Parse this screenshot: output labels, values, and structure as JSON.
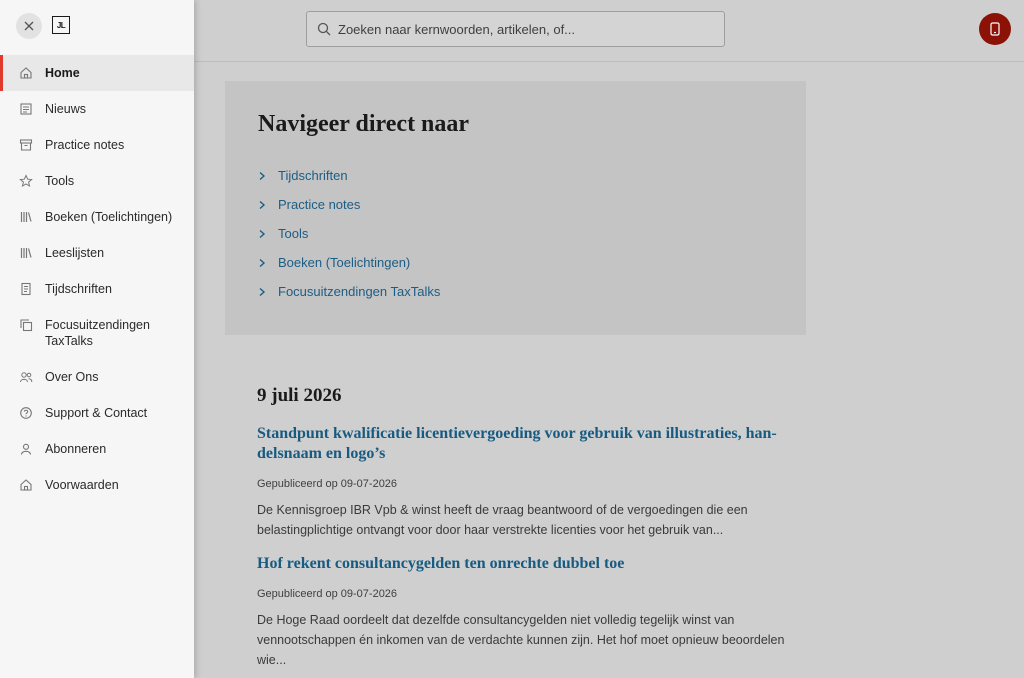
{
  "search": {
    "placeholder": "Zoeken naar kernwoorden, artikelen, of..."
  },
  "colors": {
    "accent": "#e03a2f",
    "user_button": "#8c1208",
    "link": "#1c5d85"
  },
  "drawer": {
    "logo": "JL",
    "menu": [
      {
        "label": "Home",
        "icon": "home-icon",
        "active": true
      },
      {
        "label": "Nieuws",
        "icon": "newspaper-icon"
      },
      {
        "label": "Practice notes",
        "icon": "archive-icon"
      },
      {
        "label": "Tools",
        "icon": "star-icon"
      },
      {
        "label": "Boeken (Toelichtingen)",
        "icon": "books-icon"
      },
      {
        "label": "Leeslijsten",
        "icon": "books-icon"
      },
      {
        "label": "Tijdschriften",
        "icon": "document-icon"
      },
      {
        "label": "Focusuitzendingen TaxTalks",
        "icon": "copy-icon"
      },
      {
        "label": "Over Ons",
        "icon": "users-icon"
      },
      {
        "label": "Support & Contact",
        "icon": "help-icon"
      },
      {
        "label": "Abonneren",
        "icon": "user-icon"
      },
      {
        "label": "Voorwaarden",
        "icon": "home-icon"
      }
    ]
  },
  "main": {
    "nav_title": "Navigeer direct naar",
    "nav_links": [
      "Tijdschriften",
      "Practice notes",
      "Tools",
      "Boeken (Toelichtingen)",
      "Focusuitzendingen TaxTalks"
    ],
    "news": {
      "date": "9 juli 2026",
      "articles": [
        {
          "title": "Standpunt kwalificatie licentievergoeding voor gebruik van illustraties, han-delsnaam en logo’s",
          "meta": "Gepubliceerd op 09-07-2026",
          "excerpt": "De Kennisgroep IBR Vpb & winst heeft de vraag beantwoord of de vergoedingen die een belastingplichtige ontvangt voor door haar verstrekte licenties voor het gebruik van..."
        },
        {
          "title": "Hof rekent consultancygelden ten onrechte dubbel toe",
          "meta": "Gepubliceerd op 09-07-2026",
          "excerpt": "De Hoge Raad oordeelt dat dezelfde consultancygelden niet volledig tegelijk winst van vennootschappen én inkomen van de verdachte kunnen zijn. Het hof moet opnieuw beoordelen wie..."
        }
      ]
    }
  }
}
